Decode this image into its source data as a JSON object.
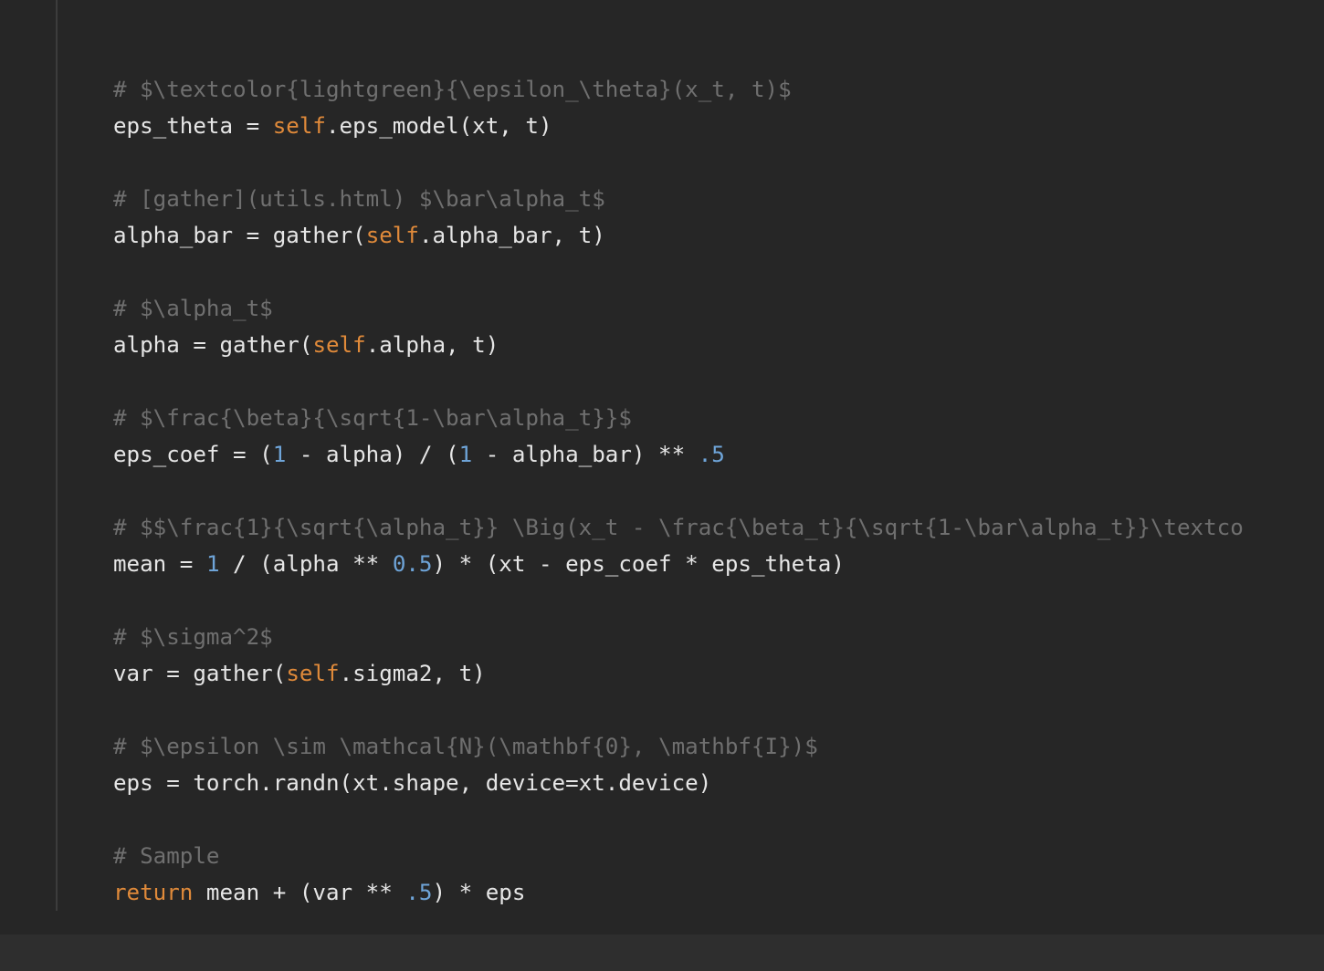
{
  "code": {
    "lines": [
      {
        "comment": "# $\\textcolor{lightgreen}{\\epsilon_\\theta}(x_t, t)$"
      },
      {
        "a": "eps_theta = ",
        "self": "self",
        "b": ".eps_model(xt, t)"
      },
      {},
      {
        "comment": "# [gather](utils.html) $\\bar\\alpha_t$"
      },
      {
        "a": "alpha_bar = gather(",
        "self": "self",
        "b": ".alpha_bar, t)"
      },
      {},
      {
        "comment": "# $\\alpha_t$"
      },
      {
        "a": "alpha = gather(",
        "self": "self",
        "b": ".alpha, t)"
      },
      {},
      {
        "comment": "# $\\frac{\\beta}{\\sqrt{1-\\bar\\alpha_t}}$"
      },
      {
        "a": "eps_coef = (",
        "n1": "1",
        "b": " - alpha) / (",
        "n2": "1",
        "c": " - alpha_bar) ** ",
        "n3": ".5"
      },
      {},
      {
        "comment": "# $$\\frac{1}{\\sqrt{\\alpha_t}} \\Big(x_t - \\frac{\\beta_t}{\\sqrt{1-\\bar\\alpha_t}}\\textco"
      },
      {
        "a": "mean = ",
        "n1": "1",
        "b": " / (alpha ** ",
        "n2": "0.5",
        "c": ") * (xt - eps_coef * eps_theta)"
      },
      {},
      {
        "comment": "# $\\sigma^2$"
      },
      {
        "a": "var = gather(",
        "self": "self",
        "b": ".sigma2, t)"
      },
      {},
      {
        "comment": "# $\\epsilon \\sim \\mathcal{N}(\\mathbf{0}, \\mathbf{I})$"
      },
      {
        "a": "eps = torch.randn(xt.shape, device=xt.device)"
      },
      {},
      {
        "comment": "# Sample"
      },
      {
        "kw": "return",
        "a": " mean + (var ** ",
        "n1": ".5",
        "b": ") * eps"
      }
    ]
  },
  "colors": {
    "background": "#262626",
    "text": "#e6e6e6",
    "comment": "#6f6f6f",
    "keyword": "#e08a3a",
    "number": "#6ea4d8"
  }
}
